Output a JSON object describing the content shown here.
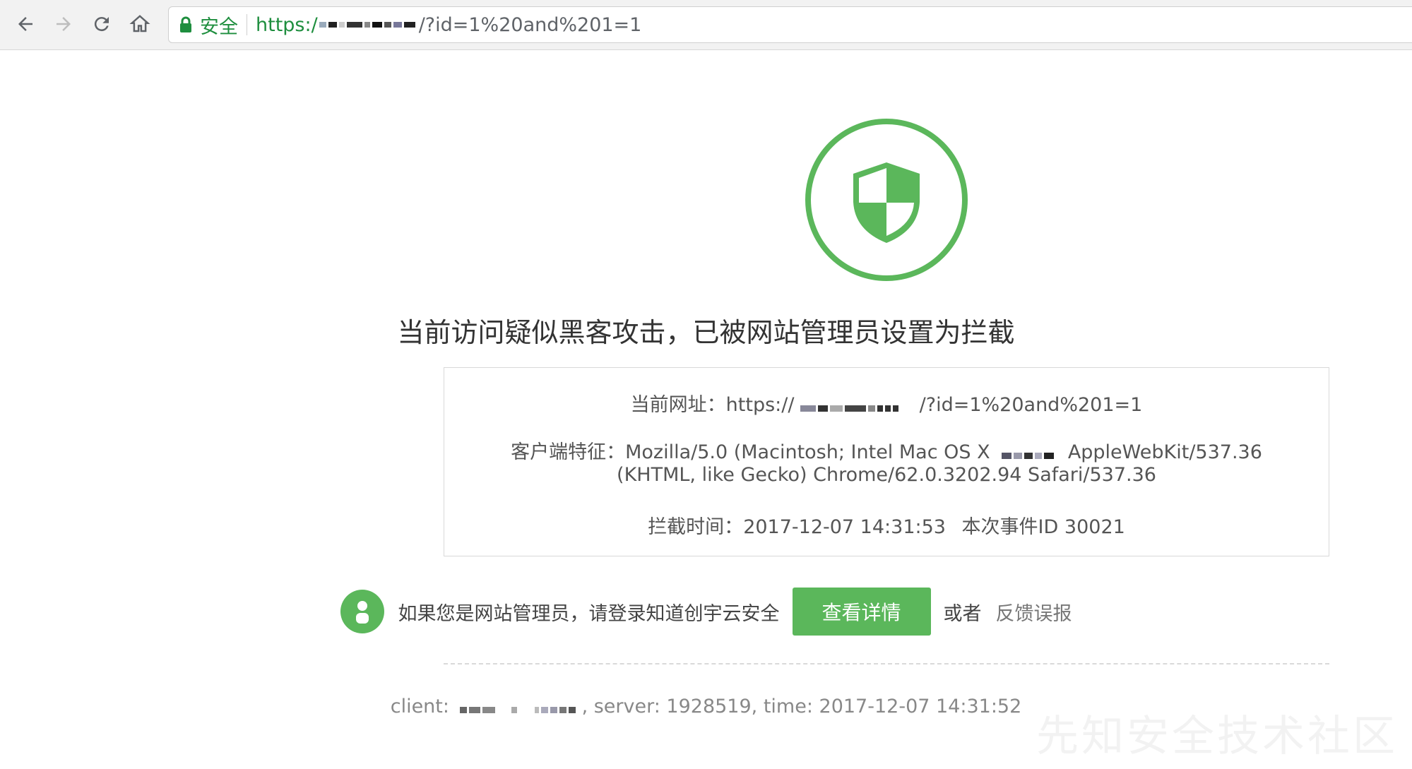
{
  "browser": {
    "secure_label": "安全",
    "url_prefix": "https:/",
    "url_suffix": "/?id=1%20and%201=1"
  },
  "block": {
    "headline": "当前访问疑似黑客攻击，已被网站管理员设置为拦截",
    "current_url_label": "当前网址：",
    "current_url_prefix": "https://",
    "current_url_suffix": "/?id=1%20and%201=1",
    "client_label": "客户端特征：",
    "client_ua_part1": "Mozilla/5.0 (Macintosh; Intel Mac OS X",
    "client_ua_part2": "AppleWebKit/537.36",
    "client_ua_line2": "(KHTML, like Gecko) Chrome/62.0.3202.94 Safari/537.36",
    "intercept_time_label": "拦截时间：",
    "intercept_time": "2017-12-07 14:31:53",
    "event_id_label": "本次事件ID",
    "event_id": "30021"
  },
  "admin": {
    "prompt": "如果您是网站管理员，请登录知道创宇云安全",
    "detail_button": "查看详情",
    "or_text": "或者",
    "feedback_link": "反馈误报"
  },
  "footer": {
    "client_label": "client:",
    "server_text": ", server: 1928519, time: 2017-12-07 14:31:52"
  },
  "watermark": "先知安全技术社区",
  "colors": {
    "accent_green": "#5bb75b",
    "secure_green": "#1e8e3e"
  }
}
